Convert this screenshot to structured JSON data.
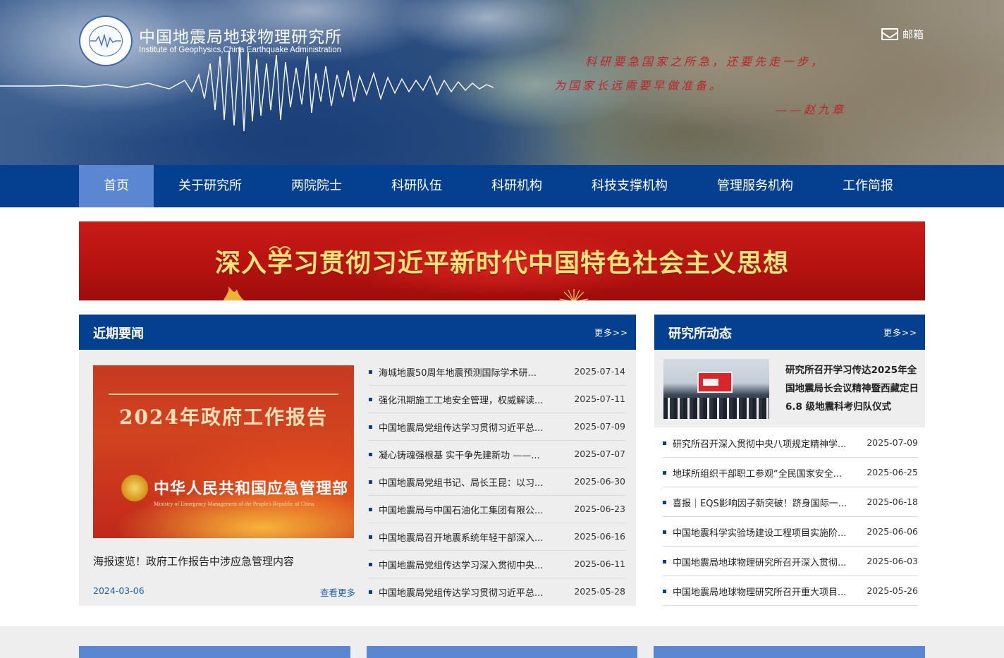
{
  "header": {
    "title": "中国地震局地球物理研究所",
    "subtitle": "Institute of Geophysics,China Earthquake Administration",
    "mail_label": "邮箱",
    "quote_line1": "科研要急国家之所急，还要先走一步，",
    "quote_line2": "为国家长远需要早做准备。",
    "quote_author": "——赵九章"
  },
  "nav": {
    "items": [
      {
        "label": "首页",
        "active": true
      },
      {
        "label": "关于研究所"
      },
      {
        "label": "两院院士"
      },
      {
        "label": "科研队伍"
      },
      {
        "label": "科研机构"
      },
      {
        "label": "科技支撑机构"
      },
      {
        "label": "管理服务机构"
      },
      {
        "label": "工作简报"
      }
    ]
  },
  "banner": {
    "text": "深入学习贯彻习近平新时代中国特色社会主义思想"
  },
  "recent_news": {
    "title": "近期要闻",
    "more": "更多>>",
    "featured": {
      "image_title": "2024年政府工作报告",
      "image_org": "中华人民共和国应急管理部",
      "image_org_en": "Ministry of Emergency Management of the People's Republic of China",
      "caption": "海报速览！政府工作报告中涉应急管理内容",
      "date": "2024-03-06",
      "view_more": "查看更多"
    },
    "items": [
      {
        "title": "海城地震50周年地震预测国际学术研...",
        "date": "2025-07-14"
      },
      {
        "title": "强化汛期施工工地安全管理，权威解读...",
        "date": "2025-07-11"
      },
      {
        "title": "中国地震局党组传达学习贯彻习近平总...",
        "date": "2025-07-09"
      },
      {
        "title": "凝心铸魂强根基 实干争先建新功 ——...",
        "date": "2025-07-07"
      },
      {
        "title": "中国地震局党组书记、局长王昆：以习...",
        "date": "2025-06-30"
      },
      {
        "title": "中国地震局与中国石油化工集团有限公...",
        "date": "2025-06-23"
      },
      {
        "title": "中国地震局召开地震系统年轻干部深入...",
        "date": "2025-06-16"
      },
      {
        "title": "中国地震局党组传达学习深入贯彻中央...",
        "date": "2025-06-11"
      },
      {
        "title": "中国地震局党组传达学习贯彻习近平总...",
        "date": "2025-05-28"
      }
    ]
  },
  "institute_news": {
    "title": "研究所动态",
    "more": "更多>>",
    "featured_text": "研究所召开学习传达2025年全国地震局长会议精神暨西藏定日6.8 级地震科考归队仪式",
    "items": [
      {
        "title": "研究所召开深入贯彻中央八项规定精神学...",
        "date": "2025-07-09"
      },
      {
        "title": "地球所组织干部职工参观“全民国家安全...",
        "date": "2025-06-25"
      },
      {
        "title": "喜报｜EQS影响因子新突破！跻身国际一...",
        "date": "2025-06-18"
      },
      {
        "title": "中国地震科学实验场建设工程项目实施阶...",
        "date": "2025-06-06"
      },
      {
        "title": "中国地震局地球物理研究所召开深入贯彻...",
        "date": "2025-06-03"
      },
      {
        "title": "中国地震局地球物理研究所召开重大项目...",
        "date": "2025-05-26"
      }
    ]
  },
  "colors": {
    "primary": "#04408f",
    "nav_active": "#5b87d2",
    "banner_red": "#c81b18",
    "banner_gold": "#fbe27a"
  }
}
